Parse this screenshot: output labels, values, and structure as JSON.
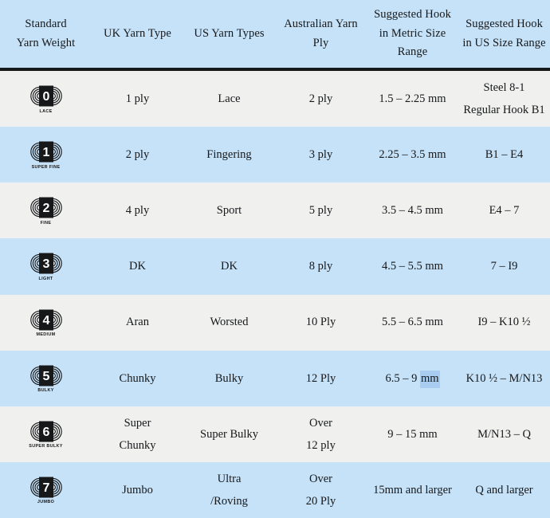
{
  "table": {
    "columns": [
      {
        "id": "standard-yarn-weight",
        "lines": [
          "Standard",
          "Yarn Weight"
        ]
      },
      {
        "id": "uk-yarn-type",
        "lines": [
          "UK Yarn Type"
        ]
      },
      {
        "id": "us-yarn-types",
        "lines": [
          "US Yarn Types"
        ]
      },
      {
        "id": "australian-yarn-ply",
        "lines": [
          "Australian Yarn",
          "Ply"
        ]
      },
      {
        "id": "suggested-hook-metric",
        "lines": [
          "Suggested Hook",
          "in Metric Size",
          "Range"
        ]
      },
      {
        "id": "suggested-hook-us",
        "lines": [
          "Suggested Hook",
          "in US Size Range"
        ]
      }
    ],
    "rows": [
      {
        "symbol": {
          "number": "0",
          "label": "LACE"
        },
        "uk": [
          "1 ply"
        ],
        "us": [
          "Lace"
        ],
        "au": [
          "2 ply"
        ],
        "metric": [
          "1.5 – 2.25 mm"
        ],
        "ussize": [
          "Steel 8-1",
          "Regular Hook B1"
        ]
      },
      {
        "symbol": {
          "number": "1",
          "label": "SUPER FINE"
        },
        "uk": [
          "2 ply"
        ],
        "us": [
          "Fingering"
        ],
        "au": [
          "3 ply"
        ],
        "metric": [
          "2.25 – 3.5 mm"
        ],
        "ussize": [
          "B1 – E4"
        ]
      },
      {
        "symbol": {
          "number": "2",
          "label": "FINE"
        },
        "uk": [
          "4 ply"
        ],
        "us": [
          "Sport"
        ],
        "au": [
          "5 ply"
        ],
        "metric": [
          "3.5 – 4.5 mm"
        ],
        "ussize": [
          "E4 – 7"
        ]
      },
      {
        "symbol": {
          "number": "3",
          "label": "LIGHT"
        },
        "uk": [
          "DK"
        ],
        "us": [
          "DK"
        ],
        "au": [
          "8 ply"
        ],
        "metric": [
          "4.5 – 5.5 mm"
        ],
        "ussize": [
          "7 – I9"
        ]
      },
      {
        "symbol": {
          "number": "4",
          "label": "MEDIUM"
        },
        "uk": [
          "Aran"
        ],
        "us": [
          "Worsted"
        ],
        "au": [
          "10 Ply"
        ],
        "metric": [
          "5.5 – 6.5 mm"
        ],
        "ussize": [
          "I9 – K10 ½"
        ]
      },
      {
        "symbol": {
          "number": "5",
          "label": "BULKY"
        },
        "uk": [
          "Chunky"
        ],
        "us": [
          "Bulky"
        ],
        "au": [
          "12 Ply"
        ],
        "metric_prefix": "6.5 – 9 ",
        "metric_selected": "mm",
        "ussize": [
          "K10 ½ – M/N13"
        ]
      },
      {
        "symbol": {
          "number": "6",
          "label": "SUPER BULKY"
        },
        "uk": [
          "Super",
          "Chunky"
        ],
        "us": [
          "Super Bulky"
        ],
        "au": [
          "Over",
          "12 ply"
        ],
        "metric": [
          "9 – 15 mm"
        ],
        "ussize": [
          "M/N13 – Q"
        ]
      },
      {
        "symbol": {
          "number": "7",
          "label": "JUMBO"
        },
        "uk": [
          "Jumbo"
        ],
        "us": [
          "Ultra",
          "/Roving"
        ],
        "au": [
          "Over",
          "20 Ply"
        ],
        "metric": [
          "15mm and larger"
        ],
        "ussize": [
          "Q and larger"
        ]
      }
    ]
  },
  "colors": {
    "header_background": "#c6e2f8",
    "row_blue": "#c6e2f8",
    "row_gray": "#f0f0ef",
    "text": "#16181a",
    "divider": "#16181a",
    "selection_highlight": "#a8cdf0"
  }
}
